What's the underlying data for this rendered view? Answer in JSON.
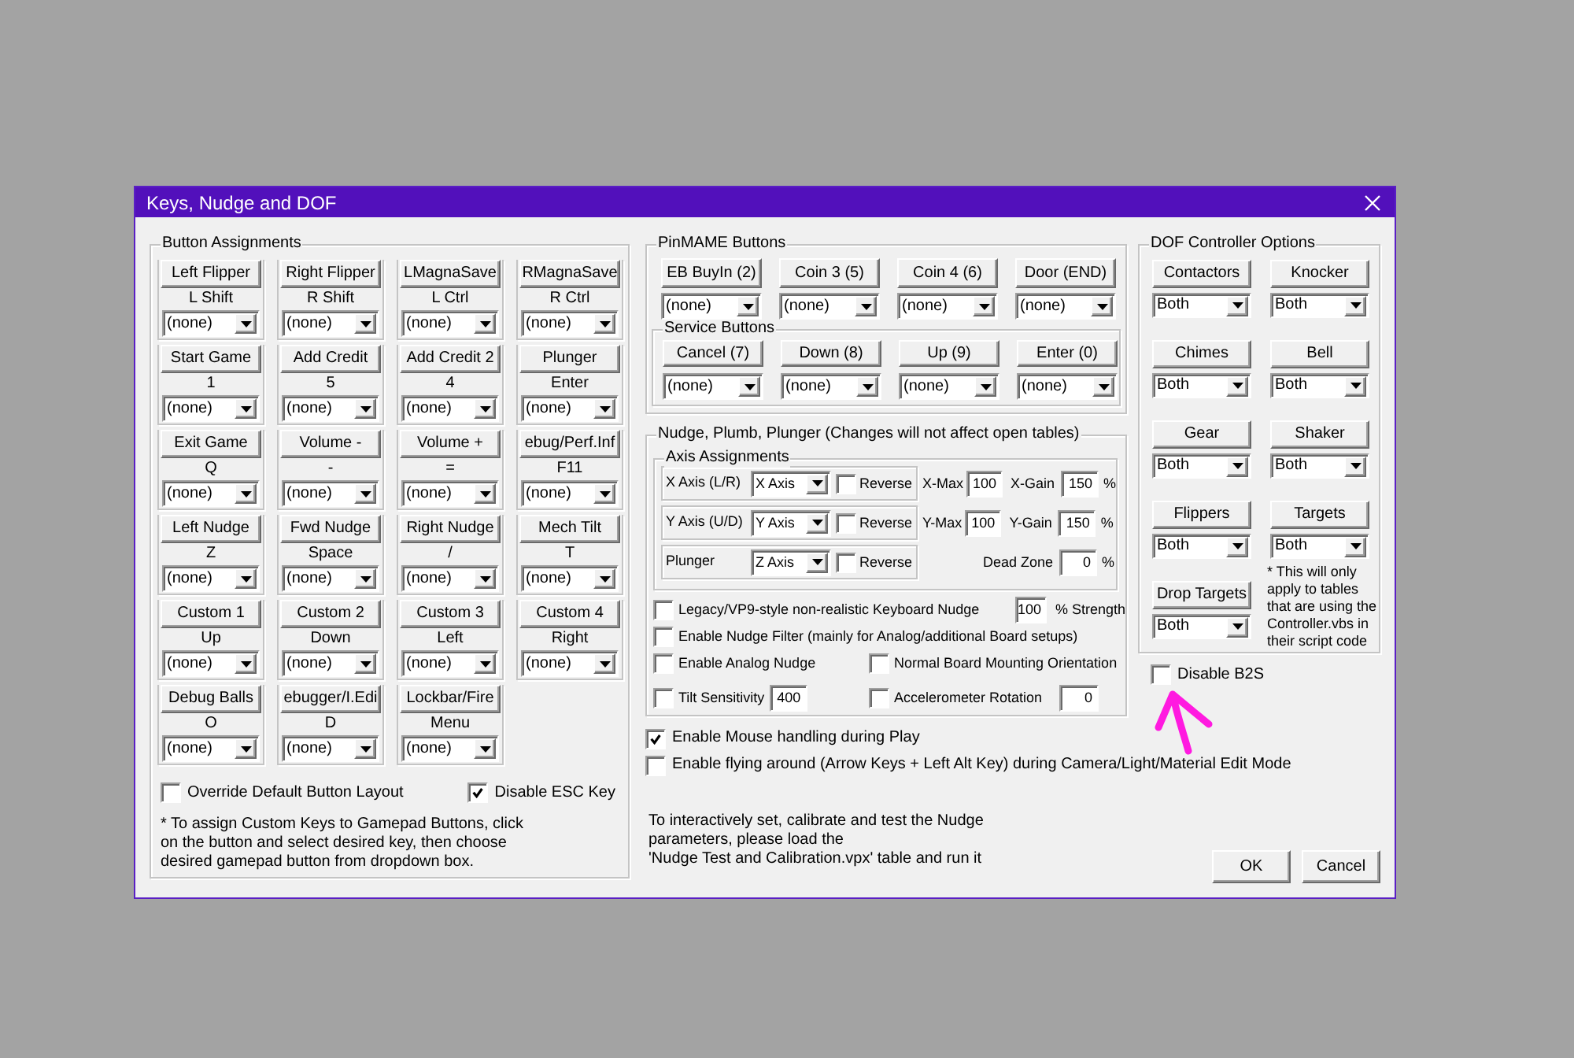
{
  "window": {
    "title": "Keys, Nudge and DOF"
  },
  "button_assignments": {
    "title": "Button Assignments",
    "cells": [
      {
        "button": "Left Flipper",
        "key": "L Shift",
        "assignment": "(none)"
      },
      {
        "button": "Right Flipper",
        "key": "R Shift",
        "assignment": "(none)"
      },
      {
        "button": "LMagnaSave",
        "key": "L Ctrl",
        "assignment": "(none)"
      },
      {
        "button": "RMagnaSave",
        "key": "R Ctrl",
        "assignment": "(none)"
      },
      {
        "button": "Start Game",
        "key": "1",
        "assignment": "(none)"
      },
      {
        "button": "Add Credit",
        "key": "5",
        "assignment": "(none)"
      },
      {
        "button": "Add Credit 2",
        "key": "4",
        "assignment": "(none)"
      },
      {
        "button": "Plunger",
        "key": "Enter",
        "assignment": "(none)"
      },
      {
        "button": "Exit Game",
        "key": "Q",
        "assignment": "(none)"
      },
      {
        "button": "Volume -",
        "key": "-",
        "assignment": "(none)"
      },
      {
        "button": "Volume +",
        "key": "=",
        "assignment": "(none)"
      },
      {
        "button": "ebug/Perf.Inf",
        "key": "F11",
        "assignment": "(none)"
      },
      {
        "button": "Left Nudge",
        "key": "Z",
        "assignment": "(none)"
      },
      {
        "button": "Fwd Nudge",
        "key": "Space",
        "assignment": "(none)"
      },
      {
        "button": "Right Nudge",
        "key": "/",
        "assignment": "(none)"
      },
      {
        "button": "Mech Tilt",
        "key": "T",
        "assignment": "(none)"
      },
      {
        "button": "Custom 1",
        "key": "Up",
        "assignment": "(none)"
      },
      {
        "button": "Custom 2",
        "key": "Down",
        "assignment": "(none)"
      },
      {
        "button": "Custom 3",
        "key": "Left",
        "assignment": "(none)"
      },
      {
        "button": "Custom 4",
        "key": "Right",
        "assignment": "(none)"
      },
      {
        "button": "Debug Balls",
        "key": "O",
        "assignment": "(none)"
      },
      {
        "button": "ebugger/I.Edi",
        "key": "D",
        "assignment": "(none)"
      },
      {
        "button": "Lockbar/Fire",
        "key": "Menu",
        "assignment": "(none)"
      }
    ],
    "checkboxes": [
      {
        "label": "Override Default Button Layout",
        "checked": false
      },
      {
        "label": "Disable ESC Key",
        "checked": true
      }
    ],
    "note": [
      "* To assign Custom Keys to Gamepad Buttons, click",
      "on the button and select desired key, then choose",
      "desired gamepad button from dropdown box."
    ]
  },
  "pinmame": {
    "title": "PinMAME Buttons",
    "buttons": [
      {
        "label": "EB BuyIn (2)",
        "assignment": "(none)"
      },
      {
        "label": "Coin 3 (5)",
        "assignment": "(none)"
      },
      {
        "label": "Coin 4 (6)",
        "assignment": "(none)"
      },
      {
        "label": "Door (END)",
        "assignment": "(none)"
      }
    ],
    "service": {
      "title": "Service Buttons",
      "buttons": [
        {
          "label": "Cancel (7)",
          "assignment": "(none)"
        },
        {
          "label": "Down (8)",
          "assignment": "(none)"
        },
        {
          "label": "Up (9)",
          "assignment": "(none)"
        },
        {
          "label": "Enter (0)",
          "assignment": "(none)"
        }
      ]
    }
  },
  "nudge": {
    "title": "Nudge, Plumb, Plunger (Changes will not affect open tables)",
    "axis_assignments": {
      "title": "Axis Assignments",
      "rows": [
        {
          "kind": "axis",
          "label": "X Axis (L/R)",
          "axis": "X Axis",
          "reverse_label": "Reverse",
          "reverse": false,
          "max_label": "X-Max",
          "max": "100",
          "gain_label": "X-Gain",
          "gain": "150",
          "unit": "%"
        },
        {
          "kind": "axis",
          "label": "Y Axis (U/D)",
          "axis": "Y Axis",
          "reverse_label": "Reverse",
          "reverse": false,
          "max_label": "Y-Max",
          "max": "100",
          "gain_label": "Y-Gain",
          "gain": "150",
          "unit": "%"
        },
        {
          "kind": "deadzone",
          "label": "Plunger",
          "axis": "Z Axis",
          "reverse_label": "Reverse",
          "reverse": false,
          "deadzone_label": "Dead Zone",
          "deadzone": "0",
          "unit": "%"
        }
      ]
    },
    "options": [
      [
        {
          "label": "Legacy/VP9-style non-realistic Keyboard Nudge",
          "checked": false,
          "value": "100",
          "suffix": "% Strength"
        }
      ],
      [
        {
          "label": "Enable Nudge Filter (mainly for Analog/additional Board setups)",
          "checked": false
        }
      ],
      [
        {
          "label": "Enable Analog Nudge",
          "checked": false
        },
        {
          "label": "Normal Board Mounting Orientation",
          "checked": false
        }
      ],
      [
        {
          "label": "Tilt Sensitivity",
          "checked": false,
          "value": "400"
        },
        {
          "label": "Accelerometer Rotation",
          "checked": false,
          "value": "0"
        }
      ]
    ]
  },
  "play_options": [
    {
      "label": "Enable Mouse handling during Play",
      "checked": true
    },
    {
      "label": "Enable flying around (Arrow Keys + Left Alt Key) during Camera/Light/Material Edit Mode",
      "checked": false
    }
  ],
  "nudge_note": [
    "To interactively set, calibrate and test the Nudge",
    "parameters, please load the",
    "'Nudge Test and Calibration.vpx' table and run it"
  ],
  "dof": {
    "title": "DOF Controller Options",
    "outputs": [
      {
        "label": "Contactors",
        "mode": "Both"
      },
      {
        "label": "Knocker",
        "mode": "Both"
      },
      {
        "label": "Chimes",
        "mode": "Both"
      },
      {
        "label": "Bell",
        "mode": "Both"
      },
      {
        "label": "Gear",
        "mode": "Both"
      },
      {
        "label": "Shaker",
        "mode": "Both"
      },
      {
        "label": "Flippers",
        "mode": "Both"
      },
      {
        "label": "Targets",
        "mode": "Both"
      },
      {
        "label": "Drop Targets",
        "mode": "Both"
      }
    ],
    "note": [
      "* This will only",
      "apply to tables",
      "that are using the",
      "Controller.vbs in",
      "their script code"
    ]
  },
  "b2s": {
    "label": "Disable B2S",
    "checked": false
  },
  "buttons": [
    "OK",
    "Cancel"
  ]
}
